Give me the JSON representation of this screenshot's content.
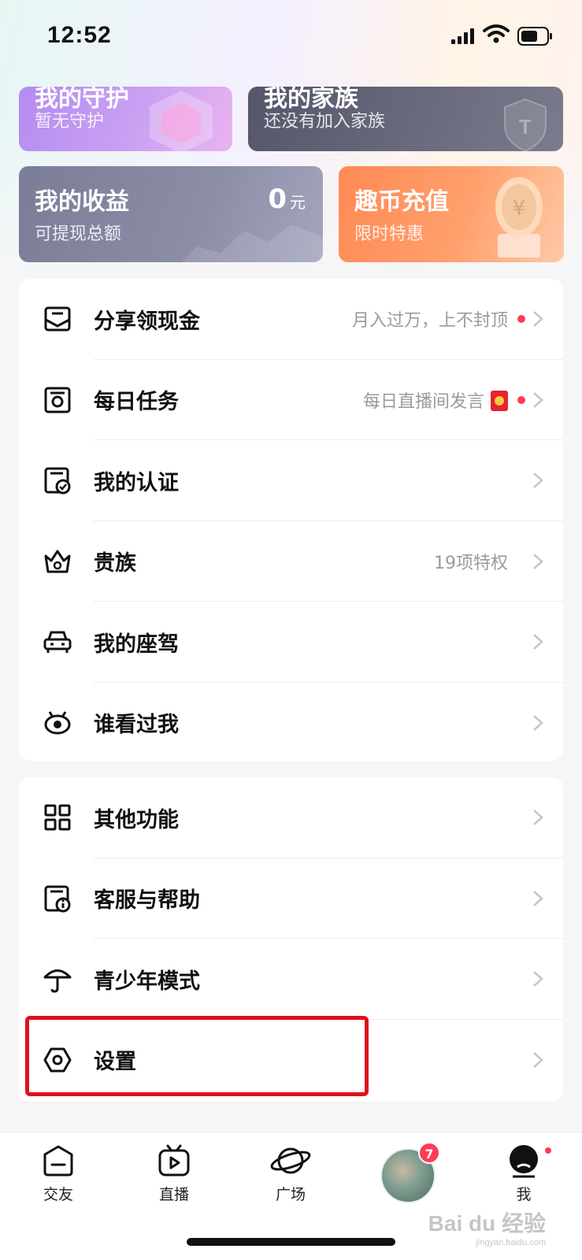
{
  "status_bar": {
    "time": "12:52"
  },
  "cards": {
    "guard": {
      "title": "我的守护",
      "subtitle": "暂无守护"
    },
    "family": {
      "title": "我的家族",
      "subtitle": "还没有加入家族"
    },
    "income": {
      "title": "我的收益",
      "subtitle": "可提现总额",
      "value": "0",
      "unit": "元"
    },
    "recharge": {
      "title": "趣币充值",
      "subtitle": "限时特惠"
    }
  },
  "menu_group_1": [
    {
      "label": "分享领现金",
      "hint": "月入过万，上不封顶",
      "dot": true,
      "icon": "share-cash-icon"
    },
    {
      "label": "每日任务",
      "hint": "每日直播间发言",
      "dot": true,
      "icon": "daily-task-icon"
    },
    {
      "label": "我的认证",
      "hint": "",
      "dot": false,
      "icon": "certification-icon"
    },
    {
      "label": "贵族",
      "hint": "19项特权",
      "dot": false,
      "icon": "crown-icon"
    },
    {
      "label": "我的座驾",
      "hint": "",
      "dot": false,
      "icon": "car-icon"
    },
    {
      "label": "谁看过我",
      "hint": "",
      "dot": false,
      "icon": "eye-icon"
    }
  ],
  "menu_group_2": [
    {
      "label": "其他功能",
      "icon": "grid-icon"
    },
    {
      "label": "客服与帮助",
      "icon": "help-icon"
    },
    {
      "label": "青少年模式",
      "icon": "umbrella-icon"
    },
    {
      "label": "设置",
      "icon": "settings-icon"
    }
  ],
  "tab_bar": {
    "tabs": [
      {
        "label": "交友",
        "icon": "friends-icon"
      },
      {
        "label": "直播",
        "icon": "live-icon"
      },
      {
        "label": "广场",
        "icon": "planet-icon"
      },
      {
        "label": "",
        "icon": "avatar",
        "badge": "7"
      },
      {
        "label": "我",
        "icon": "me-icon"
      }
    ]
  },
  "watermark": {
    "brand": "Bai du 经验",
    "url": "jingyan.baidu.com"
  },
  "colors": {
    "accent": "#ff3b55",
    "highlight_box": "#e0101e"
  }
}
